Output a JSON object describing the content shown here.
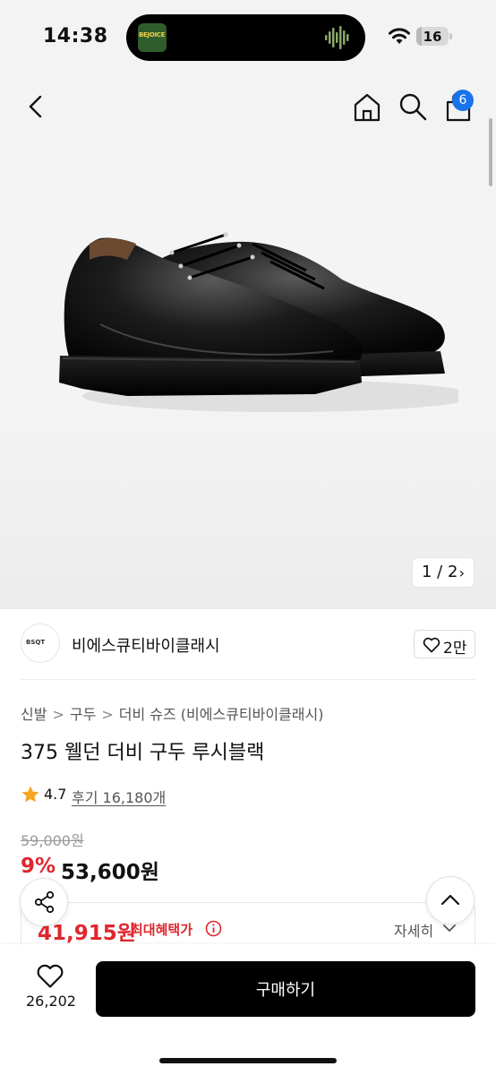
{
  "status_bar": {
    "time": "14:38",
    "island_app_label": "BEJOICE",
    "battery": "16",
    "battery_level": 0.16
  },
  "nav": {
    "cart_count": "6"
  },
  "gallery": {
    "pager": "1 / 2"
  },
  "brand": {
    "logo_text": "BSQT",
    "name": "비에스큐티바이클래시",
    "likes": "2만"
  },
  "breadcrumb": [
    "신발",
    "구두",
    "더비 슈즈 (비에스큐티바이클래시)"
  ],
  "product": {
    "title": "375 웰던 더비 구두 루시블랙",
    "rating": "4.7",
    "reviews": "후기 16,180개"
  },
  "price": {
    "original": "59,000원",
    "discount": "9%",
    "sale": "53,600원",
    "max_benefit": "41,915원",
    "max_benefit_label": "최대혜택가",
    "detail_label": "자세히"
  },
  "bottom": {
    "wish_count": "26,202",
    "buy_label": "구매하기"
  },
  "colors": {
    "accent_red": "#e0262d",
    "badge_blue": "#1a73e8",
    "buy_button": "#000000"
  }
}
